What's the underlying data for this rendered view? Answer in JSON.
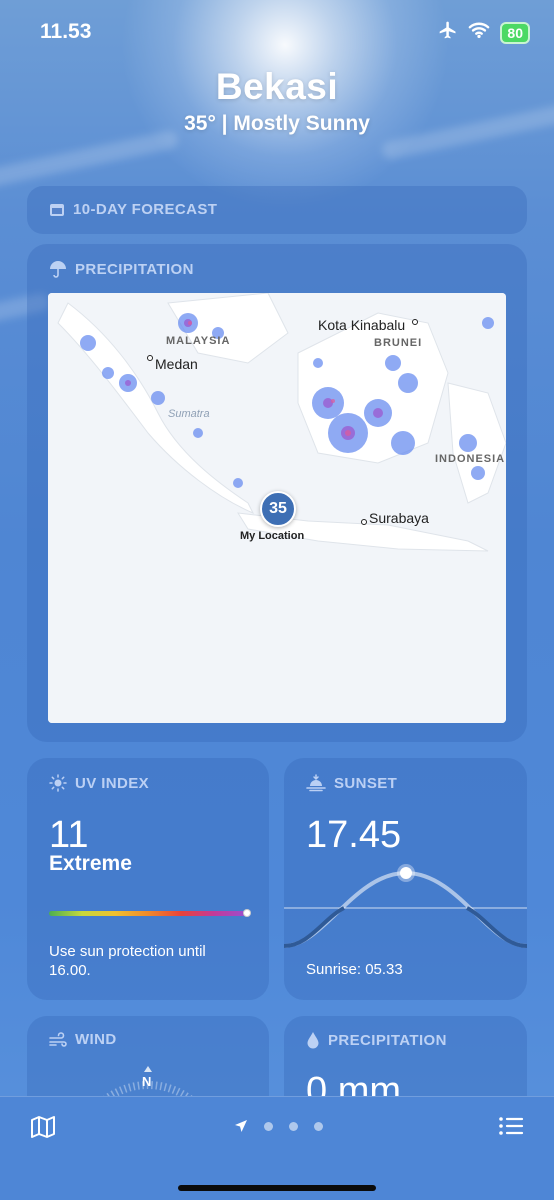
{
  "status_bar": {
    "time": "11.53",
    "battery": "80",
    "icons": [
      "airplane-icon",
      "wifi-icon",
      "battery-charging-icon"
    ]
  },
  "header": {
    "city": "Bekasi",
    "summary": "35°  |  Mostly Sunny"
  },
  "forecast_card": {
    "title": "10-DAY FORECAST",
    "icon": "calendar-icon"
  },
  "precipitation_map": {
    "title": "PRECIPITATION",
    "icon": "umbrella-icon",
    "labels": {
      "kota_kinabalu": "Kota Kinabalu",
      "malaysia": "MALAYSIA",
      "brunei": "BRUNEI",
      "medan": "Medan",
      "sumatra": "Sumatra",
      "indonesia": "INDONESIA",
      "surabaya": "Surabaya",
      "my_location": "My Location"
    },
    "location_temp": "35"
  },
  "uv_index": {
    "title": "UV INDEX",
    "icon": "sun-icon",
    "value": "11",
    "level": "Extreme",
    "scale_position": 1.0,
    "advice": "Use sun protection until 16.00."
  },
  "sunset": {
    "title": "SUNSET",
    "icon": "sunset-icon",
    "value": "17.45",
    "sunrise": "Sunrise: 05.33"
  },
  "wind": {
    "title": "WIND",
    "icon": "wind-icon",
    "compass_north": "N"
  },
  "precipitation": {
    "title": "PRECIPITATION",
    "icon": "drop-icon",
    "value": "0 mm"
  },
  "tab_bar": {
    "left_icon": "map-icon",
    "right_icon": "list-icon",
    "page_indicator": [
      "location-arrow-icon",
      "dot",
      "dot",
      "dot"
    ]
  },
  "colors": {
    "battery_green": "#4cd964",
    "pin_blue": "#3e6fb4"
  }
}
